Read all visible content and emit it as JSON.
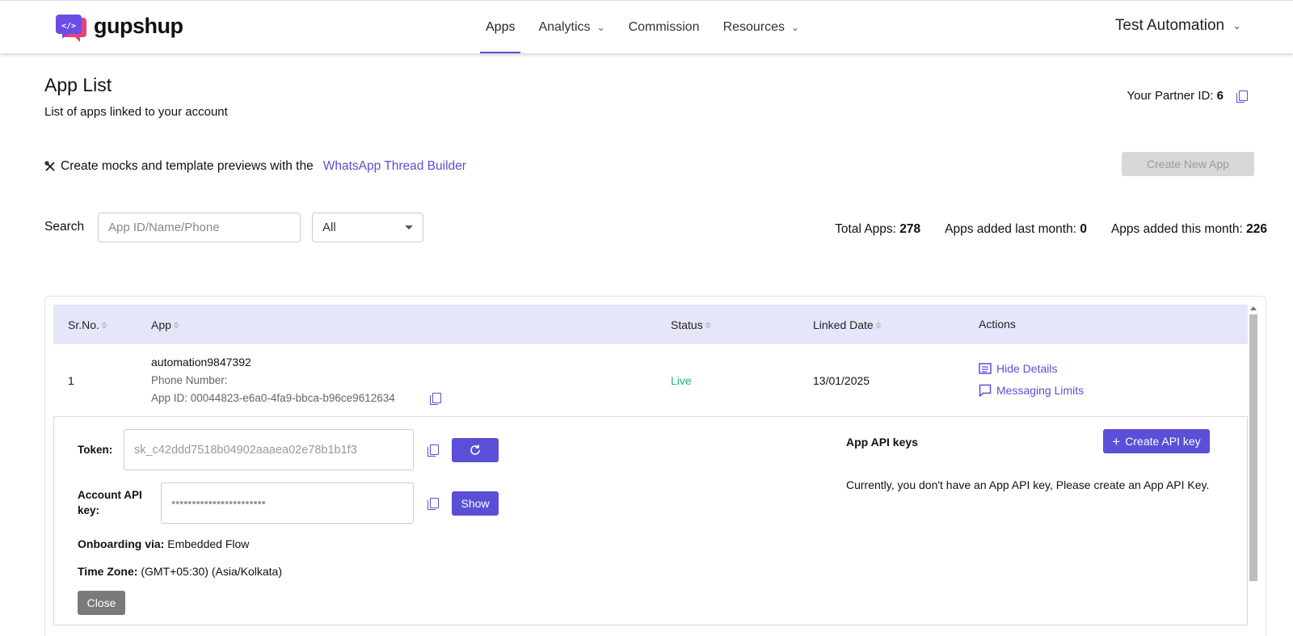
{
  "brand": {
    "name": "gupshup",
    "accent": "#5a4fd6"
  },
  "nav": {
    "items": [
      {
        "label": "Apps"
      },
      {
        "label": "Analytics"
      },
      {
        "label": "Commission"
      },
      {
        "label": "Resources"
      }
    ],
    "user": "Test Automation"
  },
  "page": {
    "title": "App List",
    "subtitle": "List of apps linked to your account",
    "partner_label": "Your Partner ID:",
    "partner_id": "6",
    "builder_text": "Create mocks and template previews with the",
    "builder_link": "WhatsApp Thread Builder",
    "create_app": "Create New App"
  },
  "search": {
    "label": "Search",
    "placeholder": "App ID/Name/Phone",
    "filter": "All"
  },
  "stats": {
    "total_label": "Total Apps:",
    "total": "278",
    "last_month_label": "Apps added last month:",
    "last_month": "0",
    "this_month_label": "Apps added this month:",
    "this_month": "226"
  },
  "table": {
    "headers": {
      "sr": "Sr.No.",
      "app": "App",
      "status": "Status",
      "date": "Linked Date",
      "actions": "Actions"
    },
    "row": {
      "sr": "1",
      "name": "automation9847392",
      "phone": "Phone Number:",
      "app_id": "App ID: 00044823-e6a0-4fa9-bbca-b96ce9612634",
      "status": "Live",
      "date": "13/01/2025",
      "hide_details": "Hide Details",
      "messaging_limits": "Messaging Limits"
    }
  },
  "details": {
    "token_label": "Token:",
    "token_value": "sk_c42ddd7518b04902aaaea02e78b1b1f3",
    "account_key_label_1": "Account API",
    "account_key_label_2": "key:",
    "account_key_value": "•••••••••••••••••••••••",
    "show": "Show",
    "onboarding_label": "Onboarding via:",
    "onboarding_value": "Embedded Flow",
    "timezone_label": "Time Zone:",
    "timezone_value": "(GMT+05:30) (Asia/Kolkata)",
    "close": "Close",
    "api_keys_title": "App API keys",
    "create_key": "Create API key",
    "no_keys": "Currently, you don't have an App API key, Please create an App API Key."
  }
}
